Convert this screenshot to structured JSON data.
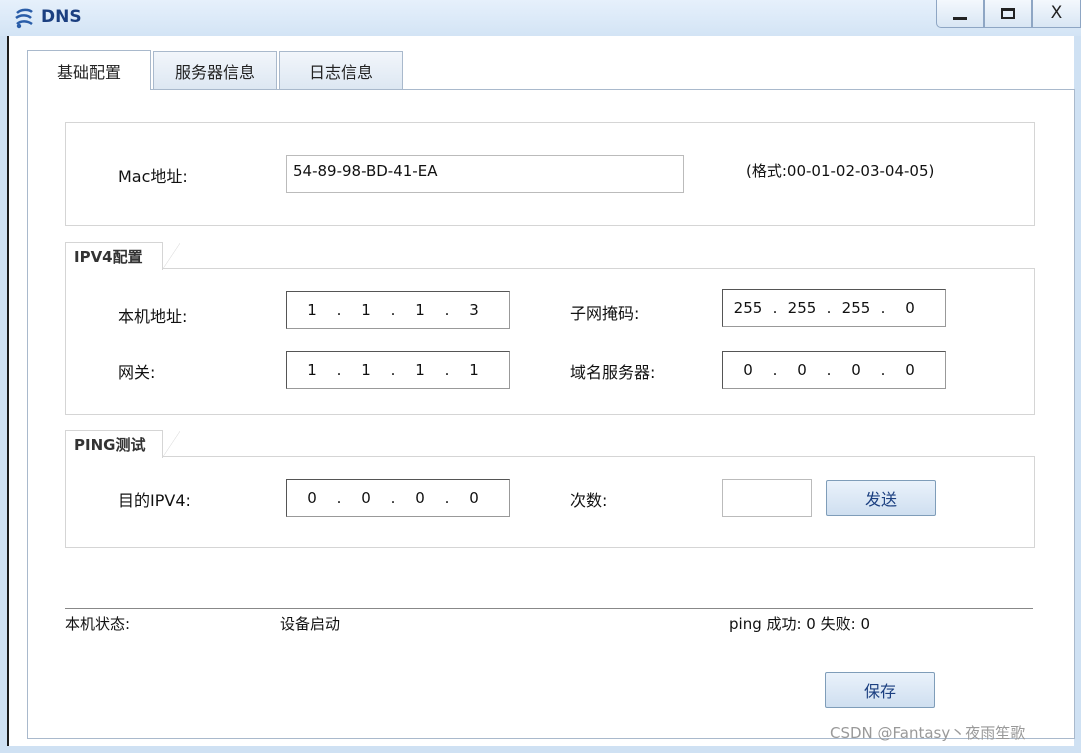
{
  "window": {
    "title": "DNS",
    "minimize_label": "_",
    "close_label": "X"
  },
  "tabs": [
    {
      "label": "基础配置"
    },
    {
      "label": "服务器信息"
    },
    {
      "label": "日志信息"
    }
  ],
  "mac_section": {
    "label": "Mac地址:",
    "value": "54-89-98-BD-41-EA",
    "format_hint": "(格式:00-01-02-03-04-05)"
  },
  "ipv4_section": {
    "title": "IPV4配置",
    "local_ip_label": "本机地址:",
    "local_ip": [
      "1",
      "1",
      "1",
      "3"
    ],
    "subnet_label": "子网掩码:",
    "subnet": [
      "255",
      "255",
      "255",
      "0"
    ],
    "gateway_label": "网关:",
    "gateway": [
      "1",
      "1",
      "1",
      "1"
    ],
    "dns_label": "域名服务器:",
    "dns": [
      "0",
      "0",
      "0",
      "0"
    ]
  },
  "ping_section": {
    "title": "PING测试",
    "target_label": "目的IPV4:",
    "target": [
      "0",
      "0",
      "0",
      "0"
    ],
    "count_label": "次数:",
    "count_value": "",
    "send_label": "发送"
  },
  "status": {
    "label": "本机状态:",
    "value": "设备启动",
    "ping_result": "ping 成功: 0 失败: 0"
  },
  "save_label": "保存",
  "watermark": "CSDN @Fantasy丶夜雨笙歌"
}
